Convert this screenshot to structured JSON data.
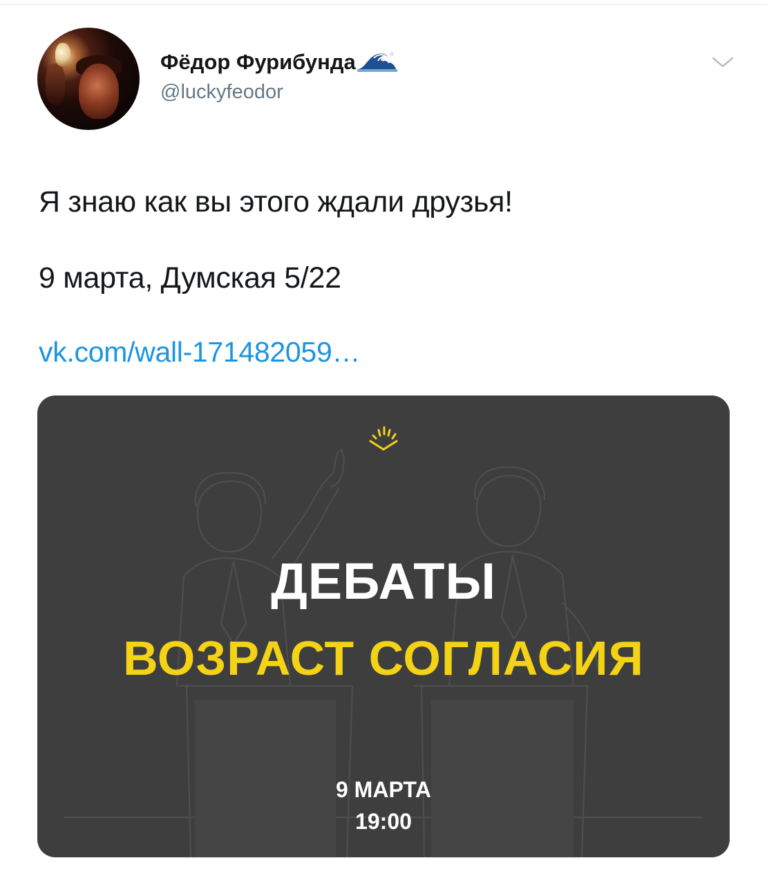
{
  "tweet": {
    "display_name": "Фёдор Фурибунда",
    "name_emoji_icon": "wave-icon",
    "username": "@luckyfeodor",
    "menu_icon": "chevron-down-icon",
    "text_lines": [
      "Я знаю как вы этого ждали друзья!",
      "9 марта, Думская 5/22"
    ],
    "link": "vk.com/wall-171482059…"
  },
  "media": {
    "title": "ДЕБАТЫ",
    "subtitle": "ВОЗРАСТ СОГЛАСИЯ",
    "date": "9 МАРТА",
    "time": "19:00",
    "colors": {
      "background": "#3e3e3e",
      "title": "#ffffff",
      "subtitle": "#f4d216",
      "logo": "#f4d216"
    },
    "logo_icon": "sunrise-logo-icon"
  }
}
